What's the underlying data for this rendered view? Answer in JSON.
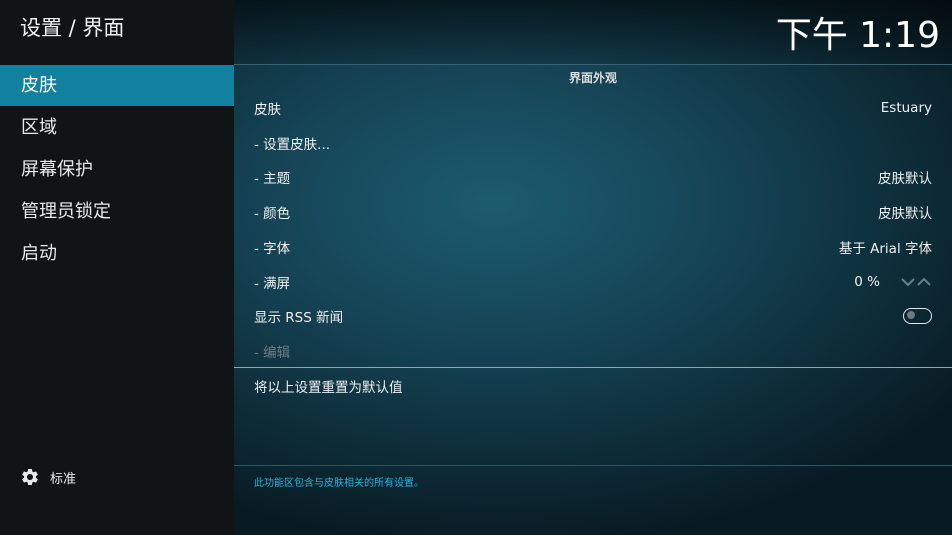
{
  "header": {
    "title": "设置 / 界面",
    "clock": "下午 1:19"
  },
  "sidebar": {
    "items": [
      {
        "label": "皮肤",
        "active": true
      },
      {
        "label": "区域",
        "active": false
      },
      {
        "label": "屏幕保护",
        "active": false
      },
      {
        "label": "管理员锁定",
        "active": false
      },
      {
        "label": "启动",
        "active": false
      }
    ],
    "level_label": "标准",
    "level_icon": "gear-icon"
  },
  "section": {
    "title": "界面外观"
  },
  "settings": {
    "skin": {
      "label": "皮肤",
      "value": "Estuary"
    },
    "configure": {
      "label": "- 设置皮肤..."
    },
    "theme": {
      "label": "- 主题",
      "value": "皮肤默认"
    },
    "colors": {
      "label": "- 颜色",
      "value": "皮肤默认"
    },
    "fonts": {
      "label": "- 字体",
      "value": "基于 Arial 字体"
    },
    "zoom": {
      "label": "- 满屏",
      "value": "0 %"
    },
    "rss": {
      "label": "显示 RSS 新闻",
      "enabled": false
    },
    "edit": {
      "label": "- 编辑",
      "disabled": true
    },
    "reset": {
      "label": "将以上设置重置为默认值"
    }
  },
  "description": "此功能区包含与皮肤相关的所有设置。",
  "colors": {
    "accent": "#12809f",
    "description_text": "#27b4e0",
    "sidebar_bg": "#111417"
  }
}
